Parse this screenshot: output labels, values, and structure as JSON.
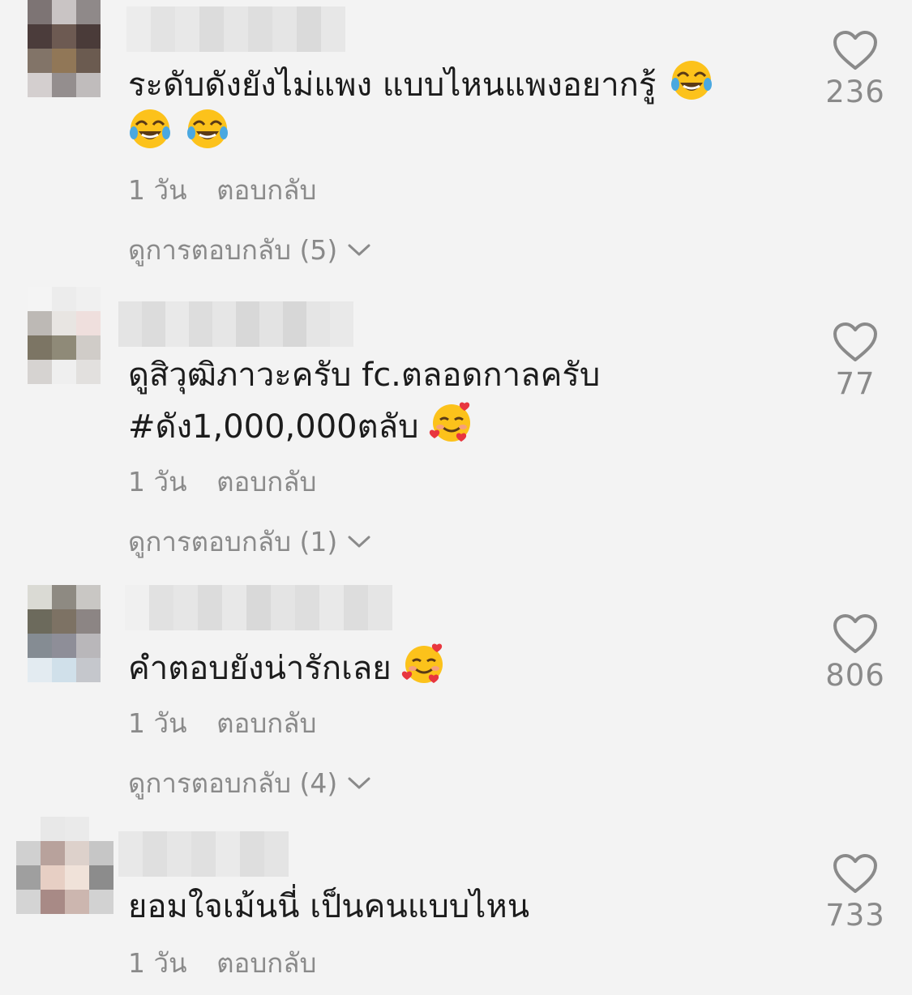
{
  "comments": [
    {
      "text": "ระดับดังยังไม่แพง แบบไหนแพงอยากรู้",
      "emojis": [
        "face-with-tears-of-joy",
        "face-with-tears-of-joy",
        "face-with-tears-of-joy"
      ],
      "date": "1 วัน",
      "reply_label": "ตอบกลับ",
      "view_replies": "ดูการตอบกลับ (5)",
      "likes": "236"
    },
    {
      "text_line1": "ดูสิวุฒิภาวะครับ fc.ตลอดกาลครับ",
      "text_line2": "#ดัง1,000,000ตลับ",
      "emojis": [
        "smiling-face-with-hearts"
      ],
      "date": "1 วัน",
      "reply_label": "ตอบกลับ",
      "view_replies": "ดูการตอบกลับ (1)",
      "likes": "77"
    },
    {
      "text": "คำตอบยังน่ารักเลย",
      "emojis": [
        "smiling-face-with-hearts"
      ],
      "date": "1 วัน",
      "reply_label": "ตอบกลับ",
      "view_replies": "ดูการตอบกลับ (4)",
      "likes": "806"
    },
    {
      "text": "ยอมใจเม้นนี่ เป็นคนแบบไหน",
      "date": "1 วัน",
      "reply_label": "ตอบกลับ",
      "likes": "733"
    }
  ],
  "colors": {
    "background": "#f3f3f3",
    "text": "#1c1c1c",
    "secondary": "#8a8a8a"
  },
  "icons": {
    "like": "heart-outline-icon",
    "expand": "chevron-down-icon"
  }
}
